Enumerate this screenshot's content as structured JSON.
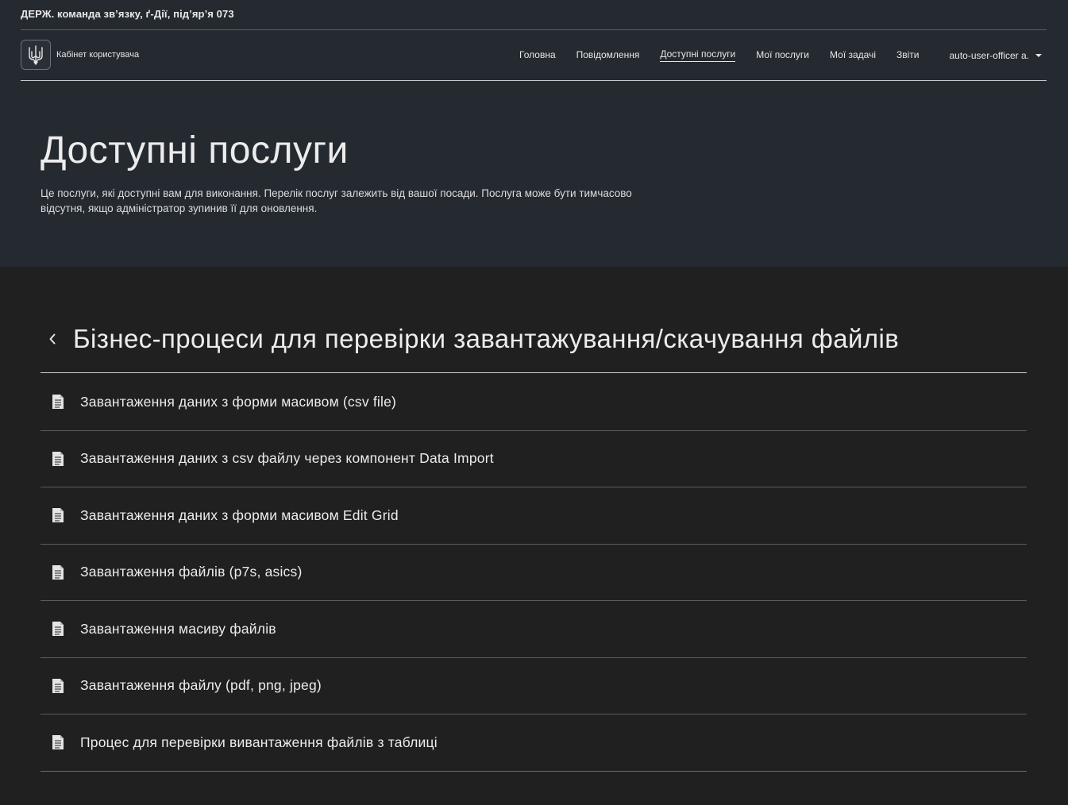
{
  "header": {
    "org_line": "ДЕРЖ. команда зв’язку, ґ-Дії, під’яр’я 073",
    "brand_name": "Кабінет користувача",
    "brand_logo_icon": "trident-icon",
    "nav": {
      "home": "Головна",
      "notifications": "Повідомлення",
      "available_services": "Доступні послуги",
      "my_services": "Мої послуги",
      "my_tasks": "Мої задачі",
      "reports": "Звіти"
    },
    "active_nav": "available_services",
    "user_name": "auto-user-officer a.",
    "user_menu_icon": "caret-down-icon"
  },
  "page": {
    "title": "Доступні послуги",
    "description": "Це послуги, які доступні вам для виконання. Перелік послуг залежить від вашої посади. Послуга може бути тимчасово відсутня, якщо адміністратор зупинив її для оновлення."
  },
  "group": {
    "back_icon": "chevron-left-icon",
    "title": "Бізнес-процеси для перевірки завантажування/скачування файлів"
  },
  "services": [
    {
      "label": "Завантаження даних з форми масивом (csv file)",
      "icon": "document-icon"
    },
    {
      "label": "Завантаження даних з csv файлу через компонент Data Import",
      "icon": "document-icon"
    },
    {
      "label": "Завантаження даних з форми масивом Edit Grid",
      "icon": "document-icon"
    },
    {
      "label": "Завантаження файлів (p7s, asics)",
      "icon": "document-icon"
    },
    {
      "label": "Завантаження масиву файлів",
      "icon": "document-icon"
    },
    {
      "label": "Завантаження файлу (pdf, png, jpeg)",
      "icon": "document-icon"
    },
    {
      "label": "Процес для перевірки вивантаження файлів з таблиці",
      "icon": "document-icon"
    }
  ],
  "colors": {
    "header_bg": "#252a31",
    "page_bg": "#202020",
    "text": "#e6e6e6",
    "divider": "#5c5c5c"
  }
}
